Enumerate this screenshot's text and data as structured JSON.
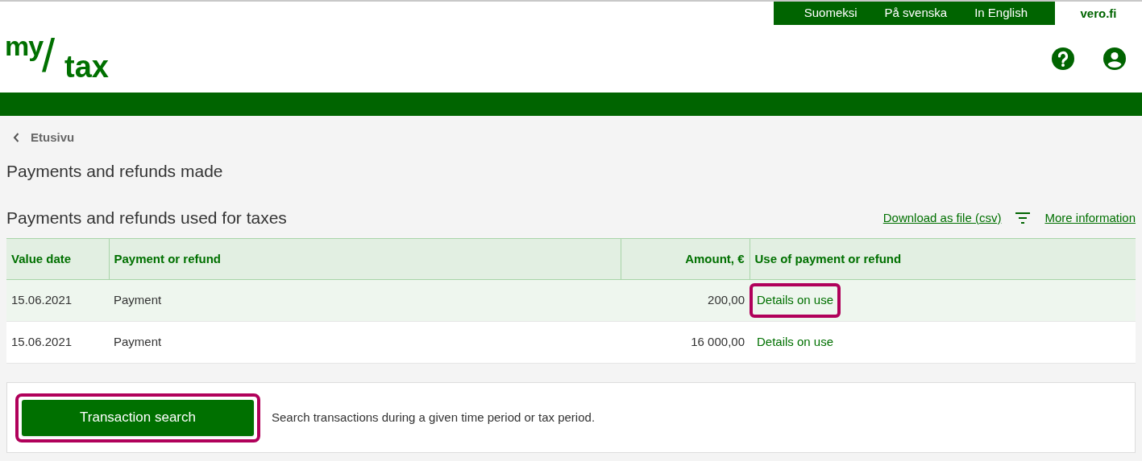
{
  "language_links": [
    {
      "label": "Suomeksi",
      "selected": false
    },
    {
      "label": "På svenska",
      "selected": false
    },
    {
      "label": "In English",
      "selected": false
    }
  ],
  "site_link": "vero.fi",
  "logo": {
    "top": "my",
    "slash": "/",
    "bottom": "tax"
  },
  "breadcrumb": "Etusivu",
  "page_title": "Payments and refunds made",
  "section_title": "Payments and refunds used for taxes",
  "actions": {
    "download": "Download as file (csv)",
    "more_info": "More information"
  },
  "table": {
    "columns": [
      {
        "label": "Value date"
      },
      {
        "label": "Payment or refund"
      },
      {
        "label": "Amount, €"
      },
      {
        "label": "Use of payment or refund"
      }
    ],
    "rows": [
      {
        "value_date": "15.06.2021",
        "type": "Payment",
        "amount": "200,00",
        "use": "Details on use",
        "hovered": true,
        "highlighted": true
      },
      {
        "value_date": "15.06.2021",
        "type": "Payment",
        "amount": "16 000,00",
        "use": "Details on use",
        "hovered": false,
        "highlighted": false
      }
    ]
  },
  "search_card": {
    "button": "Transaction search",
    "highlighted": true,
    "description": "Search transactions during a given time period or tax period."
  }
}
